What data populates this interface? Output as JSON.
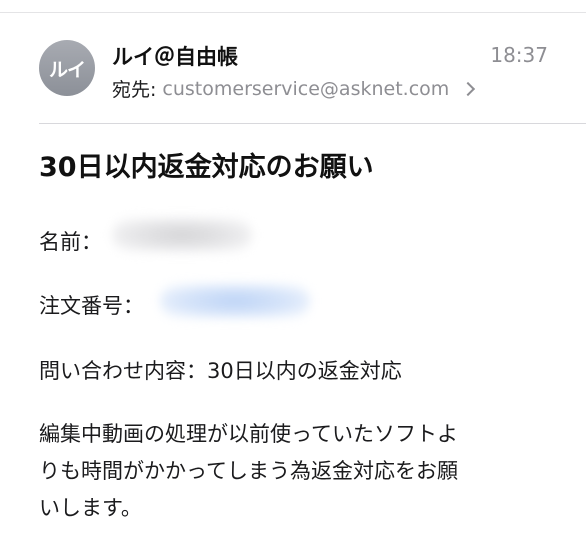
{
  "header": {
    "avatar_initials": "ルイ",
    "sender": "ルイ＠自由帳",
    "time": "18:37",
    "to_label": "宛先:",
    "to_address": "customerservice@asknet.com"
  },
  "subject": "30日以内返金対応のお願い",
  "body": {
    "name_label": "名前：",
    "order_label": "注文番号：",
    "inquiry_line": "問い合わせ内容：30日以内の返金対応",
    "paragraph_lines": [
      "編集中動画の処理が以前使っていたソフトよ",
      "りも時間がかかってしまう為返金対応をお願",
      "いします。"
    ]
  },
  "colors": {
    "avatar": "#9a9da4",
    "secondary_text": "#8e8e93",
    "redaction_name": "#dcdcde",
    "redaction_order": "#c6daf7"
  }
}
